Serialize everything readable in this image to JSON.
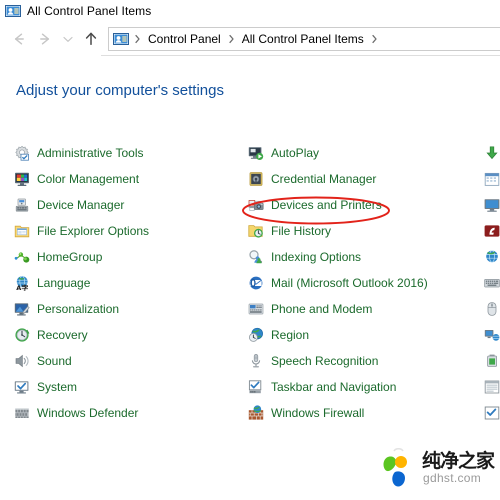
{
  "window": {
    "title": "All Control Panel Items",
    "title_icon": "control-panel-icon"
  },
  "navbar": {
    "back_icon": "back-arrow-icon",
    "forward_icon": "forward-arrow-icon",
    "recent_icon": "chevron-down-icon",
    "up_icon": "up-arrow-icon",
    "address_icon": "control-panel-icon",
    "breadcrumbs": [
      "Control Panel",
      "All Control Panel Items"
    ],
    "separator_glyph": "›"
  },
  "page": {
    "heading": "Adjust your computer's settings"
  },
  "columns": [
    {
      "name": "column-1",
      "items": [
        {
          "label": "Administrative Tools",
          "icon": "administrative-tools-icon"
        },
        {
          "label": "Color Management",
          "icon": "color-management-icon"
        },
        {
          "label": "Device Manager",
          "icon": "device-manager-icon"
        },
        {
          "label": "File Explorer Options",
          "icon": "file-explorer-options-icon"
        },
        {
          "label": "HomeGroup",
          "icon": "homegroup-icon"
        },
        {
          "label": "Language",
          "icon": "language-icon"
        },
        {
          "label": "Personalization",
          "icon": "personalization-icon"
        },
        {
          "label": "Recovery",
          "icon": "recovery-icon"
        },
        {
          "label": "Sound",
          "icon": "sound-icon"
        },
        {
          "label": "System",
          "icon": "system-icon"
        },
        {
          "label": "Windows Defender",
          "icon": "windows-defender-icon"
        }
      ]
    },
    {
      "name": "column-2",
      "items": [
        {
          "label": "AutoPlay",
          "icon": "autoplay-icon"
        },
        {
          "label": "Credential Manager",
          "icon": "credential-manager-icon"
        },
        {
          "label": "Devices and Printers",
          "icon": "devices-and-printers-icon"
        },
        {
          "label": "File History",
          "icon": "file-history-icon"
        },
        {
          "label": "Indexing Options",
          "icon": "indexing-options-icon"
        },
        {
          "label": "Mail (Microsoft Outlook 2016)",
          "icon": "mail-icon"
        },
        {
          "label": "Phone and Modem",
          "icon": "phone-and-modem-icon"
        },
        {
          "label": "Region",
          "icon": "region-icon"
        },
        {
          "label": "Speech Recognition",
          "icon": "speech-recognition-icon"
        },
        {
          "label": "Taskbar and Navigation",
          "icon": "taskbar-and-navigation-icon"
        },
        {
          "label": "Windows Firewall",
          "icon": "windows-firewall-icon"
        }
      ]
    },
    {
      "name": "column-3",
      "items": [
        {
          "label": "",
          "icon": "backup-and-restore-icon"
        },
        {
          "label": "",
          "icon": "date-and-time-icon"
        },
        {
          "label": "",
          "icon": "display-icon"
        },
        {
          "label": "",
          "icon": "flash-player-icon"
        },
        {
          "label": "",
          "icon": "internet-options-icon"
        },
        {
          "label": "",
          "icon": "keyboard-icon"
        },
        {
          "label": "",
          "icon": "mouse-icon"
        },
        {
          "label": "",
          "icon": "network-and-sharing-icon"
        },
        {
          "label": "",
          "icon": "power-options-icon"
        },
        {
          "label": "",
          "icon": "programs-and-features-icon"
        },
        {
          "label": "",
          "icon": "security-and-maintenance-icon"
        }
      ]
    }
  ],
  "annotation": {
    "type": "ellipse",
    "target": "Devices and Printers",
    "color": "#E2231A"
  },
  "watermark": {
    "text_cn": "纯净之家",
    "text_en": "gdhst.com",
    "colors": {
      "green": "#5BC521",
      "yellow": "#FFB400",
      "blue": "#0B66D0"
    }
  }
}
